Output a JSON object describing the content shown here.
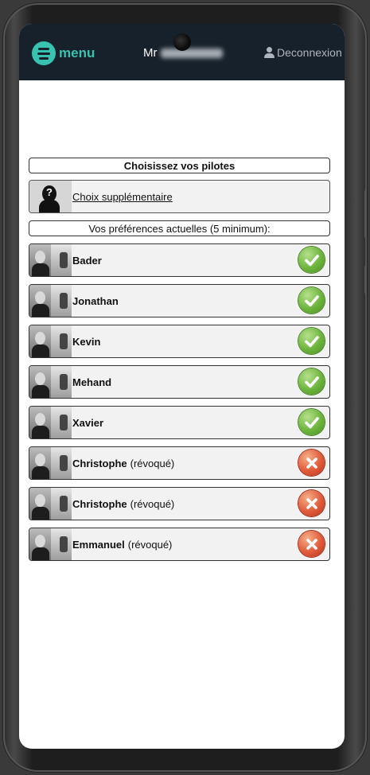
{
  "header": {
    "menu_label": "menu",
    "user_prefix": "Mr",
    "logout_label": "Deconnexion"
  },
  "selection": {
    "title": "Choisissez vos pilotes",
    "extra_choice_label": "Choix supplémentaire",
    "preferences_title": "Vos préférences actuelles (5 minimum):"
  },
  "pilots": [
    {
      "name": "Bader",
      "status": "",
      "state": "accepted"
    },
    {
      "name": "Jonathan",
      "status": "",
      "state": "accepted"
    },
    {
      "name": "Kevin",
      "status": "",
      "state": "accepted"
    },
    {
      "name": "Mehand",
      "status": "",
      "state": "accepted"
    },
    {
      "name": "Xavier",
      "status": "",
      "state": "accepted"
    },
    {
      "name": "Christophe",
      "status": "(révoqué)",
      "state": "revoked"
    },
    {
      "name": "Christophe",
      "status": "(révoqué)",
      "state": "revoked"
    },
    {
      "name": "Emmanuel",
      "status": "(révoqué)",
      "state": "revoked"
    }
  ],
  "icons": {
    "accepted": "check-icon",
    "revoked": "cross-icon",
    "unknown_pilot": "question-silhouette-icon",
    "menu": "hamburger-icon",
    "user": "user-icon"
  },
  "colors": {
    "topbar": "#17212b",
    "accent": "#38c2b0",
    "accepted": "#6cb43c",
    "revoked": "#e05a3a"
  }
}
